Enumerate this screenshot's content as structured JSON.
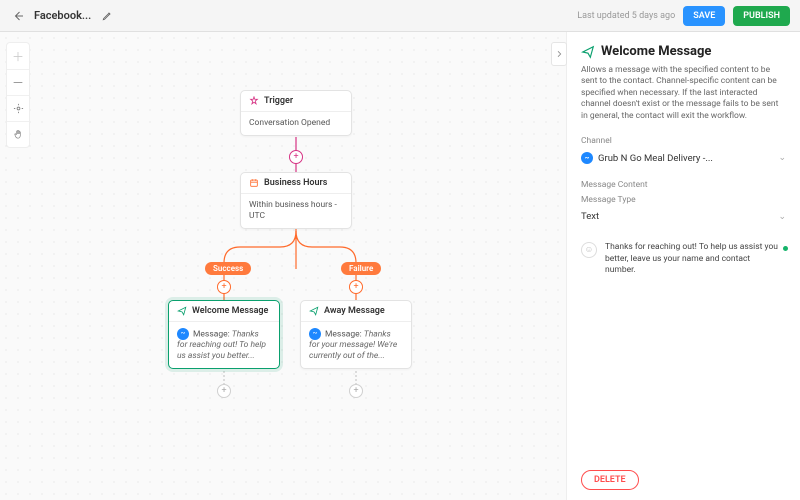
{
  "header": {
    "title": "Facebook...",
    "updated": "Last updated 5 days ago",
    "save": "SAVE",
    "publish": "PUBLISH"
  },
  "nodes": {
    "trigger": {
      "title": "Trigger",
      "body": "Conversation Opened"
    },
    "hours": {
      "title": "Business Hours",
      "body": "Within business hours - UTC"
    },
    "welcome": {
      "title": "Welcome Message",
      "prefix": "Message:",
      "body": "Thanks for reaching out! To help us assist you better..."
    },
    "away": {
      "title": "Away Message",
      "prefix": "Message:",
      "body": "Thanks for your message! We're currently out of the..."
    }
  },
  "branches": {
    "success": "Success",
    "failure": "Failure"
  },
  "panel": {
    "title": "Welcome Message",
    "description": "Allows a message with the specified content to be sent to the contact. Channel-specific content can be specified when necessary. If the last interacted channel doesn't exist or the message fails to be sent in general, the contact will exit the workflow.",
    "channel_label": "Channel",
    "channel_value": "Grub N Go Meal Delivery -...",
    "content_label": "Message Content",
    "type_label": "Message Type",
    "type_value": "Text",
    "message": "Thanks for reaching out! To help us assist you better, leave us your name and contact number.",
    "delete": "DELETE"
  }
}
